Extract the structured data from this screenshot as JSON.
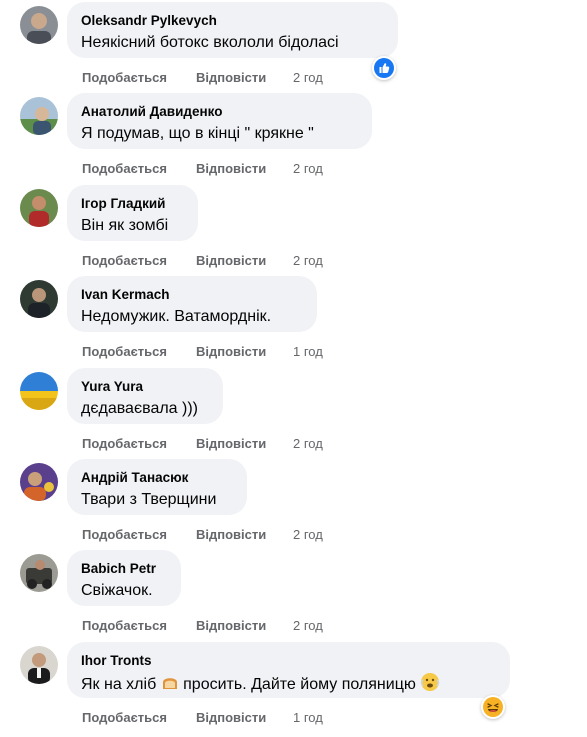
{
  "labels": {
    "like": "Подобається",
    "reply": "Відповісти"
  },
  "comments": [
    {
      "author": "Oleksandr Pylkevych",
      "text": "Неякісний ботокс вкололи бідоласі",
      "time": "2 год",
      "reaction": "like-icon"
    },
    {
      "author": "Анатолий Давиденко",
      "text": "Я подумав, що в кінці \" крякне \"",
      "time": "2 год"
    },
    {
      "author": "Ігор Гладкий",
      "text": "Він як зомбі",
      "time": "2 год"
    },
    {
      "author": "Ivan Kermach",
      "text": "Недомужик. Ватаморднік.",
      "time": "1 год"
    },
    {
      "author": "Yura Yura",
      "text": "дєдаваєвала )))",
      "time": "2 год"
    },
    {
      "author": "Андрій Танасюк",
      "text": "Твари з Тверщини",
      "time": "2 год"
    },
    {
      "author": "Babich Petr",
      "text": "Свіжачок.",
      "time": "2 год"
    },
    {
      "author": "Ihor Tronts",
      "text_before": "Як на хліб",
      "text_after": "просить. Дайте йому поляницю",
      "time": "1 год",
      "reaction": "laughing-face-icon"
    }
  ]
}
